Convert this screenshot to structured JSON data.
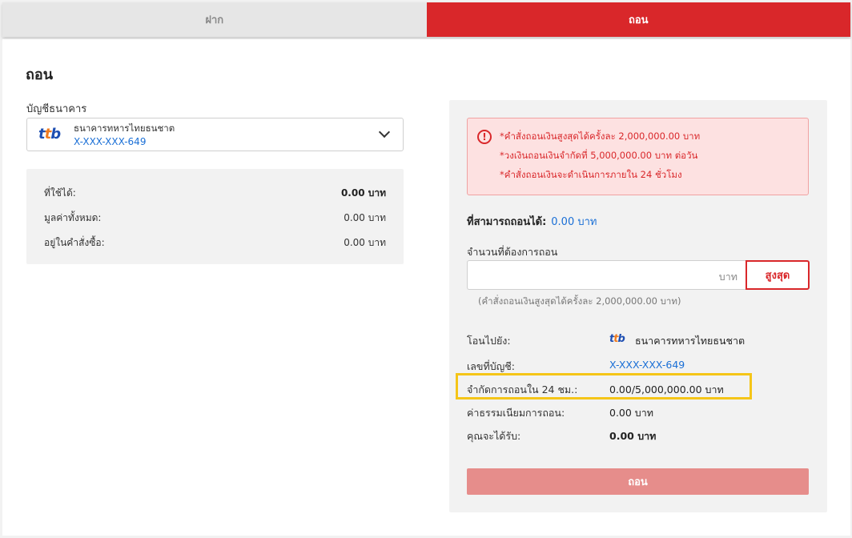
{
  "tabs": {
    "deposit": "ฝาก",
    "withdraw": "ถอน"
  },
  "page": {
    "title": "ถอน"
  },
  "bank_account": {
    "label": "บัญชีธนาคาร",
    "bank_name": "ธนาคารทหารไทยธนชาต",
    "account_number": "X-XXX-XXX-649",
    "logo_text": "ttb"
  },
  "balance": {
    "available_label": "ที่ใช้ได้:",
    "available_value": "0.00 บาท",
    "total_label": "มูลค่าทั้งหมด:",
    "total_value": "0.00 บาท",
    "in_orders_label": "อยู่ในคำสั่งซื้อ:",
    "in_orders_value": "0.00 บาท"
  },
  "notice": {
    "line1": "*คำสั่งถอนเงินสูงสุดได้ครั้งละ 2,000,000.00 บาท",
    "line2": "*วงเงินถอนเงินจำกัดที่ 5,000,000.00 บาท ต่อวัน",
    "line3": "*คำสั่งถอนเงินจะดำเนินการภายใน 24 ชั่วโมง",
    "icon": "!"
  },
  "withdrawable": {
    "label": "ที่สามารถถอนได้:",
    "value": "0.00 บาท"
  },
  "amount": {
    "label": "จำนวนที่ต้องการถอน",
    "value": "",
    "unit": "บาท",
    "max_label": "สูงสุด",
    "hint": "(คำสั่งถอนเงินสูงสุดได้ครั้งละ 2,000,000.00 บาท)"
  },
  "summary": {
    "transfer_to_label": "โอนไปยัง:",
    "transfer_to_bank": "ธนาคารทหารไทยธนชาต",
    "account_label": "เลขที่บัญชี:",
    "account_value": "X-XXX-XXX-649",
    "limit_label": "จำกัดการถอนใน 24 ชม.:",
    "limit_value": "0.00/5,000,000.00 บาท",
    "fee_label": "ค่าธรรมเนียมการถอน:",
    "fee_value": "0.00 บาท",
    "receive_label": "คุณจะได้รับ:",
    "receive_value": "0.00 บาท"
  },
  "submit": {
    "label": "ถอน"
  },
  "colors": {
    "accent": "#d9272a",
    "link": "#1a6fd6",
    "disabled_button": "#e68d8b",
    "highlight": "#f5c518"
  }
}
